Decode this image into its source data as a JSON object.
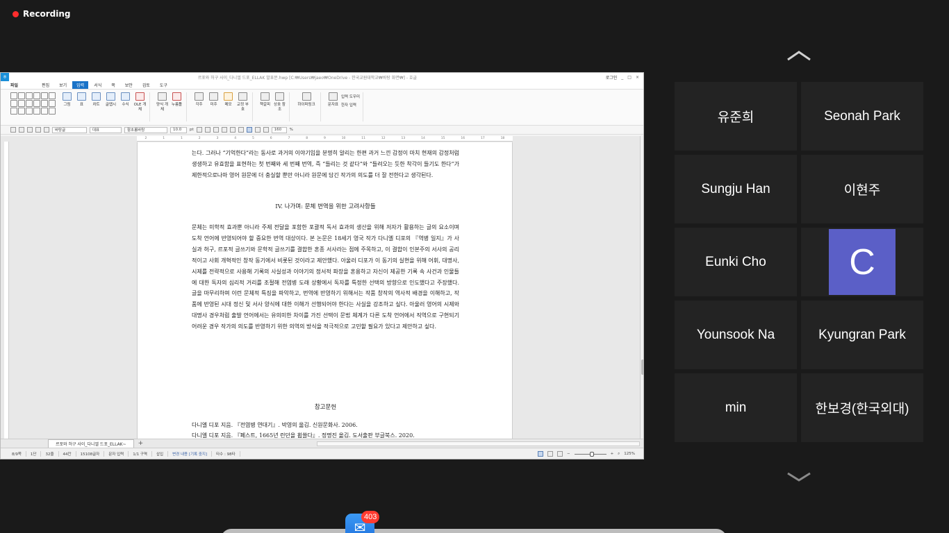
{
  "recording": {
    "label": "Recording"
  },
  "document": {
    "app_icon_letter": "ㅎ",
    "window_title": "르포와 허구 사이_다니엘 드포_ELLAK 발표문.hwp [C:₩Users₩jaeo₩OneDrive - 한국교원대학교₩바탕 화면₩] - 호글",
    "login_label": "로그인",
    "menu": [
      "파일",
      "편집",
      "보기",
      "입력",
      "서식",
      "쪽",
      "보안",
      "검토",
      "도구"
    ],
    "active_menu": "입력",
    "ribbon": {
      "group1": [
        "그림",
        "표",
        "차트",
        "글맵시",
        "수식",
        "OLE 개체"
      ],
      "group2": [
        "양식 개체",
        "누름틀"
      ],
      "group3": [
        "각주",
        "미주",
        "메모",
        "교정 부호"
      ],
      "group4": [
        "책갈피",
        "상호 참조"
      ],
      "group5": [
        "하이퍼링크"
      ],
      "group6": [
        "문자표"
      ],
      "side_items": [
        "입력 도우미",
        "한자 입력"
      ]
    },
    "format_bar": {
      "style": "바탕글",
      "lang": "대표",
      "font": "함초롬바탕",
      "size": "10.0",
      "unit": "pt",
      "zoom": "160",
      "zoom_unit": "%"
    },
    "ruler_marks": [
      "2",
      "1",
      "1",
      "2",
      "3",
      "4",
      "5",
      "6",
      "7",
      "8",
      "9",
      "10",
      "11",
      "12",
      "13",
      "14",
      "15",
      "16",
      "17",
      "18"
    ],
    "body": {
      "para1": "는다. 그러나 “기억한다”라는 동사로 과거의 이야기임을 분명히 알리는 한편 과거 느낀 감정이 마치 현재의 감정처럼 생생하고 유효함을 표현하는 첫 번째와 세 번째 번역, 즉 “들리는 것 같다”와 “들려오는 듯한 착각이 들기도 한다”가 제한적으로나마 영어 원문에 더 충실할 뿐만 아니라 원문에 담긴 작가의 의도를 더 잘 전한다고 생각된다.",
      "heading": "IV. 나가며: 문체 번역을 위한 고려사항들",
      "para2": "문체는 미학적 효과뿐 아니라 주제 전달을 포함한 포괄적 독서 효과의 생산을 위해 저자가 활용하는 글의 요소이며 도착 언어에 반영되어야 할 중요한 번역 대상이다. 본 논문은 18세기 영국 작가 다니엘 디포의 『역병 일지』가 사실과 허구, 르포적 글쓰기와 문학적 글쓰기를 결합한 혼종 서사라는 점에 주목하고, 이 결합이 인본주의 서사의 공리적이고 사회 개혁적인 창작 동기에서 비롯된 것이라고 제안했다. 아울러 디포가 이 동기의 실현을 위해 어휘, 대명사, 시제를 전략적으로 사용해 기록의 사실성과 이야기의 정서적 파장을 혼용하고 자신이 제공한 기록 속 사건과 인물들에 대한 독자의 심리적 거리를 조절해 전염병 도래 상황에서 독자를 특정한 선택의 방향으로 인도했다고 주장했다. 글을 마무리하며 이런 문체적 특징을 파악하고, 번역에 반영하기 위해서는 작품 창작의 역사적 배경을 이해하고, 작품에 반영된 시대 정신 및 서사 양식에 대한 이해가 선행되어야 한다는 사실을 강조하고 싶다. 아울러 영어의 시제와 대명사 경우처럼 출발 언어에서는 유의미한 차이를 가진 선택이 문법 체계가 다른 도착 언어에서 직역으로 구현되기 어려운 경우 작가의 의도를 반영하기 위한 의역의 방식을 적극적으로 고민할 필요가 있다고 제안하고 싶다.",
      "references_title": "참고문헌",
      "ref1": "다니엘 디포 지음. 『전염병 연대기』. 박영의 옮김. 신원문화사. 2006.",
      "ref2": "다니엘 디포 지음. 『페스트, 1665년 런던을 휩쓸다』. 정명진 옮김. 도서출판 부글북스. 2020."
    },
    "tab": {
      "label": "르포와 허구 사이_다니엘 드포_ELLAK~",
      "add": "+"
    },
    "status": [
      "8/9쪽",
      "1단",
      "32줄",
      "44칸",
      "15108글자",
      "문자 입력",
      "1/1 구역",
      "삽입",
      "변경 내용 [기록 중지]",
      "타수 : 98타"
    ],
    "zoom_status": "125%"
  },
  "gallery": {
    "up_icon": "chevron-up-icon",
    "down_icon": "chevron-down-icon",
    "participants": [
      {
        "name": "유준희"
      },
      {
        "name": "Seonah Park"
      },
      {
        "name": "Sungju Han"
      },
      {
        "name": "이현주"
      },
      {
        "name": "Eunki Cho"
      },
      {
        "name": "",
        "avatar_letter": "C",
        "avatar_color": "#5b5fc7"
      },
      {
        "name": "Younsook Na"
      },
      {
        "name": "Kyungran Park"
      },
      {
        "name": "min"
      },
      {
        "name": "한보경(한국외대)"
      }
    ]
  },
  "dock": {
    "mail_badge": "403"
  }
}
